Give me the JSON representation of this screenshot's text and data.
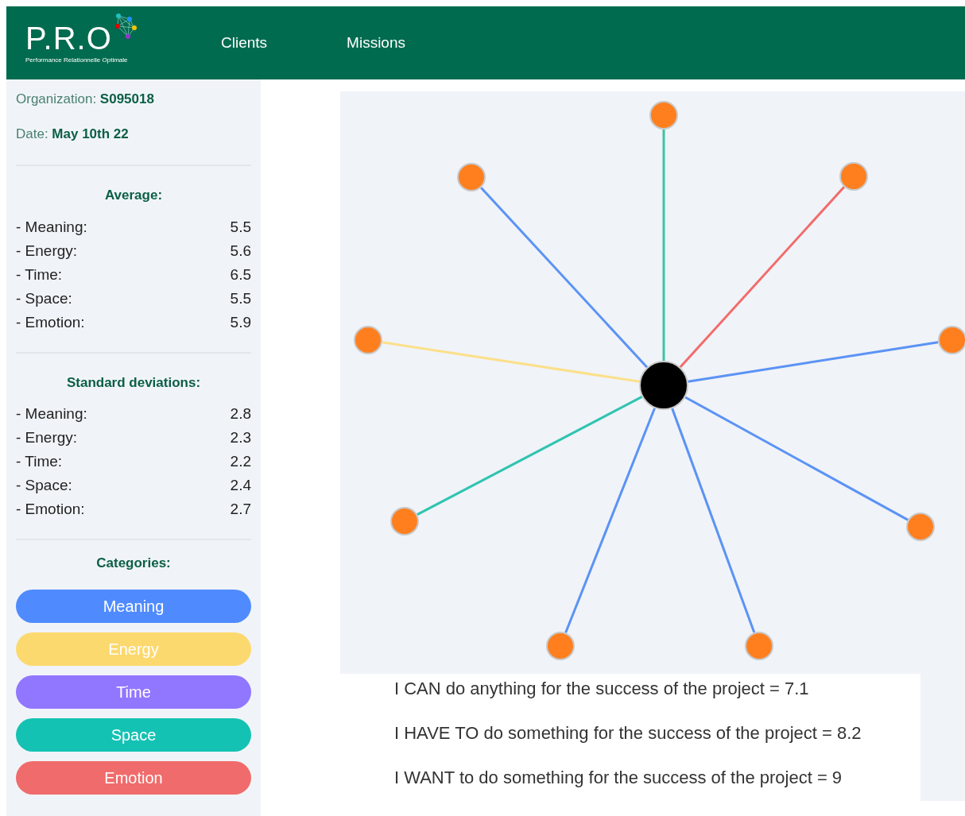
{
  "header": {
    "logo": {
      "title": "P.R.O",
      "tagline": "Performance Relationnelle Optimale"
    },
    "nav": [
      {
        "label": "Clients"
      },
      {
        "label": "Missions"
      }
    ]
  },
  "sidebar": {
    "info": [
      {
        "label": "Organization:",
        "value": "S095018"
      },
      {
        "label": "Date:",
        "value": "May 10th 22"
      }
    ],
    "sections": [
      {
        "title": "Average:",
        "rows": [
          {
            "label": "- Meaning:",
            "value": "5.5"
          },
          {
            "label": "- Energy:",
            "value": "5.6"
          },
          {
            "label": "- Time:",
            "value": "6.5"
          },
          {
            "label": "- Space:",
            "value": "5.5"
          },
          {
            "label": "- Emotion:",
            "value": "5.9"
          }
        ]
      },
      {
        "title": "Standard deviations:",
        "rows": [
          {
            "label": "- Meaning:",
            "value": "2.8"
          },
          {
            "label": "- Energy:",
            "value": "2.3"
          },
          {
            "label": "- Time:",
            "value": "2.2"
          },
          {
            "label": "- Space:",
            "value": "2.4"
          },
          {
            "label": "- Emotion:",
            "value": "2.7"
          }
        ]
      }
    ],
    "categories_title": "Categories:",
    "categories": [
      {
        "label": "Meaning",
        "color": "#4f8bff"
      },
      {
        "label": "Energy",
        "color": "#fcd96f"
      },
      {
        "label": "Time",
        "color": "#9176ff"
      },
      {
        "label": "Space",
        "color": "#14c2b3"
      },
      {
        "label": "Emotion",
        "color": "#f06b6b"
      }
    ]
  },
  "graph": {
    "edges": [
      {
        "color": "#3cc4a4"
      },
      {
        "color": "#5b93f5"
      },
      {
        "color": "#f26b6b"
      },
      {
        "color": "#fbe08a"
      },
      {
        "color": "#5b93f5"
      },
      {
        "color": "#2fc4b0"
      },
      {
        "color": "#5b93f5"
      },
      {
        "color": "#5b93f5"
      },
      {
        "color": "#5b93f5"
      }
    ]
  },
  "statements": [
    "I CAN do anything for the success of the project = 7.1",
    "I HAVE TO do something for the success of the project = 8.2",
    "I WANT to do something for the success of the project = 9"
  ]
}
